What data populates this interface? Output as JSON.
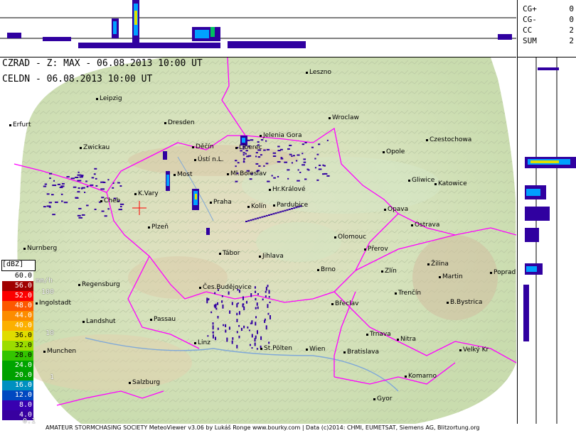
{
  "lightning": {
    "rows": [
      {
        "label": "CG+",
        "value": "0"
      },
      {
        "label": "CG-",
        "value": "0"
      },
      {
        "label": "CC",
        "value": "2"
      },
      {
        "label": "SUM",
        "value": "2"
      }
    ]
  },
  "header": {
    "line1": "CZRAD - Z: MAX - 06.08.2013 10:00 UT",
    "line2": "CELDN - 06.08.2013 10:00 UT"
  },
  "cities": [
    "Leszno",
    "Leipzig",
    "Wroclaw",
    "Erfurt",
    "Dresden",
    "Jelenia Gora",
    "Czestochowa",
    "Zwickau",
    "Děčín",
    "Liberec",
    "Opole",
    "Ústí n.L.",
    "Most",
    "Ml.Boleslav",
    "Gliwice",
    "Katowice",
    "Hr.Králové",
    "K.Vary",
    "Cheb",
    "Praha",
    "Pardubice",
    "Kolín",
    "Opava",
    "Plzeň",
    "Ostrava",
    "Olomouc",
    "Nurnberg",
    "Přerov",
    "Tábor",
    "Jihlava",
    "Žilina",
    "Brno",
    "Zlín",
    "Martin",
    "Poprad",
    "Regensburg",
    "Čes.Budějovice",
    "Trenčín",
    "Ingolstadt",
    "Břeclav",
    "B.Bystrica",
    "Passau",
    "Landshut",
    "Trnava",
    "Nitra",
    "Linz",
    "Wien",
    "St.Pölten",
    "Munchen",
    "Bratislava",
    "Velký Kr",
    "Komarno",
    "Salzburg",
    "Gyor"
  ],
  "legend": {
    "unit_dbz": "[dBZ]",
    "unit_mmh": "mm/h",
    "levels": [
      {
        "dbz": "60.0",
        "color": "#ffffff",
        "text": "#000000"
      },
      {
        "dbz": "56.0",
        "color": "#a00000",
        "text": "#ffffff"
      },
      {
        "dbz": "52.0",
        "color": "#fc0000",
        "text": "#ffffff"
      },
      {
        "dbz": "48.0",
        "color": "#fc5800",
        "text": "#ffffff"
      },
      {
        "dbz": "44.0",
        "color": "#fc8c00",
        "text": "#ffffff"
      },
      {
        "dbz": "40.0",
        "color": "#fcb000",
        "text": "#ffffff"
      },
      {
        "dbz": "36.0",
        "color": "#e0dc00",
        "text": "#000000"
      },
      {
        "dbz": "32.0",
        "color": "#9cdc00",
        "text": "#000000"
      },
      {
        "dbz": "28.0",
        "color": "#34c400",
        "text": "#000000"
      },
      {
        "dbz": "24.0",
        "color": "#00a400",
        "text": "#ffffff"
      },
      {
        "dbz": "20.0",
        "color": "#00a000",
        "text": "#ffffff"
      },
      {
        "dbz": "16.0",
        "color": "#0090c0",
        "text": "#ffffff"
      },
      {
        "dbz": "12.0",
        "color": "#0048c0",
        "text": "#ffffff"
      },
      {
        "dbz": "8.0",
        "color": "#3800b0",
        "text": "#ffffff"
      },
      {
        "dbz": "4.0",
        "color": "#3800a0",
        "text": "#ffffff"
      }
    ],
    "mmh_ticks": [
      "100",
      "10",
      "1",
      "0.1"
    ]
  },
  "footer": {
    "text": "AMATEUR STORMCHASING SOCIETY MeteoViewer v3.06 by Lukáš Ronge www.bourky.com | Data (c)2014: CHMI, EUMETSAT, Siemens AG, Blitzortung.org"
  },
  "colors": {
    "border": "#ff00ff",
    "radar_low": "#3000a0",
    "radar_mid": "#00a0ff",
    "radar_high": "#e0e000",
    "crosshair": "#ff0000",
    "terrain_low": "#cfe0b0",
    "terrain_high": "#d8c8a8"
  }
}
